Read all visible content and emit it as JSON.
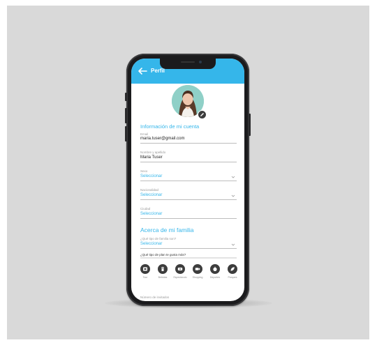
{
  "header": {
    "title": "Perfil"
  },
  "account": {
    "section_title": "Información de mi cuenta",
    "email": {
      "label": "Email",
      "value": "maria.tuser@gmail.com"
    },
    "name": {
      "label": "Nombre y apellido",
      "value": "Maria Tuser"
    },
    "sexo": {
      "label": "Sexo",
      "value": "Seleccionar"
    },
    "nacionalidad": {
      "label": "Nacionalidad",
      "value": "Seleccionar"
    },
    "ciudad": {
      "label": "Ciudad",
      "value": "Seleccionar"
    }
  },
  "family": {
    "section_title": "Acerca de mi familia",
    "relationship": {
      "label": "¿Qué tipo de familia son?",
      "value": "Seleccionar"
    },
    "question": "¿Qué tipo de plan te gusta más?",
    "options": [
      {
        "icon": "board-game-icon",
        "label": "Tour"
      },
      {
        "icon": "drink-icon",
        "label": "Bebidas"
      },
      {
        "icon": "ticket-icon",
        "label": "Espectáculo"
      },
      {
        "icon": "cinema-icon",
        "label": "Shopping"
      },
      {
        "icon": "sports-icon",
        "label": "Deportes"
      },
      {
        "icon": "nature-icon",
        "label": "Parques"
      }
    ],
    "next_label": "Número de invitados"
  },
  "colors": {
    "accent": "#35b6ea",
    "frame": "#1b1b1d",
    "backdrop": "#d9d9d9"
  }
}
